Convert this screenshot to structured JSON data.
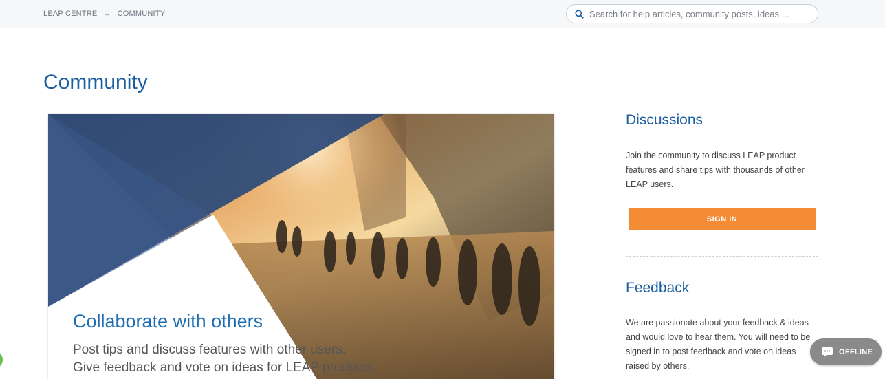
{
  "breadcrumb": {
    "items": [
      "LEAP CENTRE",
      "COMMUNITY"
    ]
  },
  "search": {
    "placeholder": "Search for help articles, community posts, ideas ..."
  },
  "page": {
    "title": "Community"
  },
  "hero": {
    "title": "Collaborate with others",
    "line1": "Post tips and discuss features with other users.",
    "line2": "Give feedback and vote on ideas for LEAP products."
  },
  "discussions": {
    "heading": "Discussions",
    "description": "Join the community to discuss LEAP product features and share tips with thousands of other LEAP users.",
    "button_label": "SIGN IN"
  },
  "feedback": {
    "heading": "Feedback",
    "description": "We are passionate about your feedback & ideas and would love to hear them. You will need to be signed in to post feedback and vote on ideas raised by others."
  },
  "chat": {
    "status_label": "OFFLINE"
  },
  "colors": {
    "accent": "#1c5fa0",
    "button": "#f48c36",
    "navy": "#2d4a78",
    "offline": "#8a8a8a"
  }
}
